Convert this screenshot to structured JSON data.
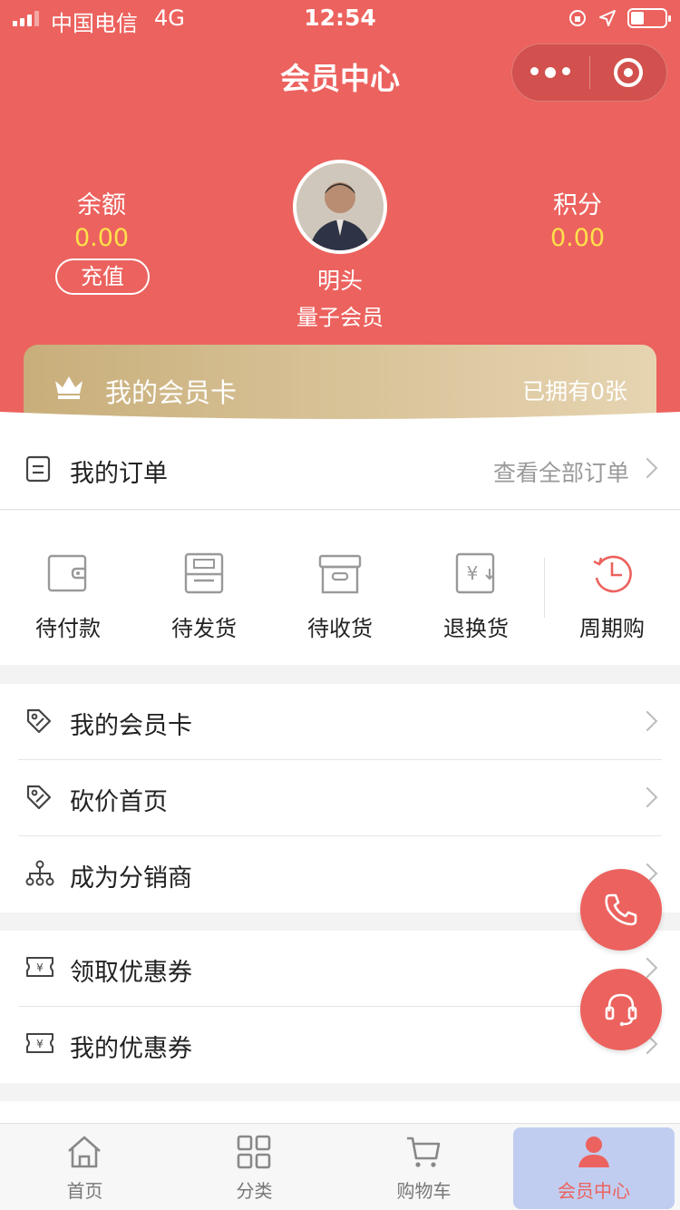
{
  "status_bar": {
    "carrier": "中国电信",
    "network": "4G",
    "time": "12:54"
  },
  "header": {
    "title": "会员中心"
  },
  "balance": {
    "label": "余额",
    "value": "0.00",
    "recharge_label": "充值"
  },
  "points": {
    "label": "积分",
    "value": "0.00"
  },
  "user": {
    "name": "明头",
    "level": "量子会员"
  },
  "vip_card": {
    "title": "我的会员卡",
    "count": "已拥有0张"
  },
  "orders": {
    "title": "我的订单",
    "view_all": "查看全部订单",
    "items": [
      {
        "label": "待付款",
        "icon": "wallet-icon"
      },
      {
        "label": "待发货",
        "icon": "box-icon"
      },
      {
        "label": "待收货",
        "icon": "package-icon"
      },
      {
        "label": "退换货",
        "icon": "refund-icon"
      },
      {
        "label": "周期购",
        "icon": "cycle-clock-icon"
      }
    ]
  },
  "menu_group_1": [
    {
      "label": "我的会员卡",
      "icon": "tag-icon"
    },
    {
      "label": "砍价首页",
      "icon": "tag-icon"
    },
    {
      "label": "成为分销商",
      "icon": "org-chart-icon"
    }
  ],
  "menu_group_2": [
    {
      "label": "领取优惠券",
      "icon": "coupon-icon"
    },
    {
      "label": "我的优惠券",
      "icon": "coupon-icon"
    }
  ],
  "fabs": {
    "phone_icon": "phone-icon",
    "service_icon": "headset-icon"
  },
  "tabbar": [
    {
      "label": "首页",
      "icon": "home-icon"
    },
    {
      "label": "分类",
      "icon": "grid-icon"
    },
    {
      "label": "购物车",
      "icon": "cart-icon"
    },
    {
      "label": "会员中心",
      "icon": "user-icon",
      "active": true
    }
  ],
  "colors": {
    "brand": "#ec625e",
    "value_yellow": "#ffe14b",
    "gold": "#d2bb8d",
    "active_tab_bg": "#c1cdf0"
  }
}
